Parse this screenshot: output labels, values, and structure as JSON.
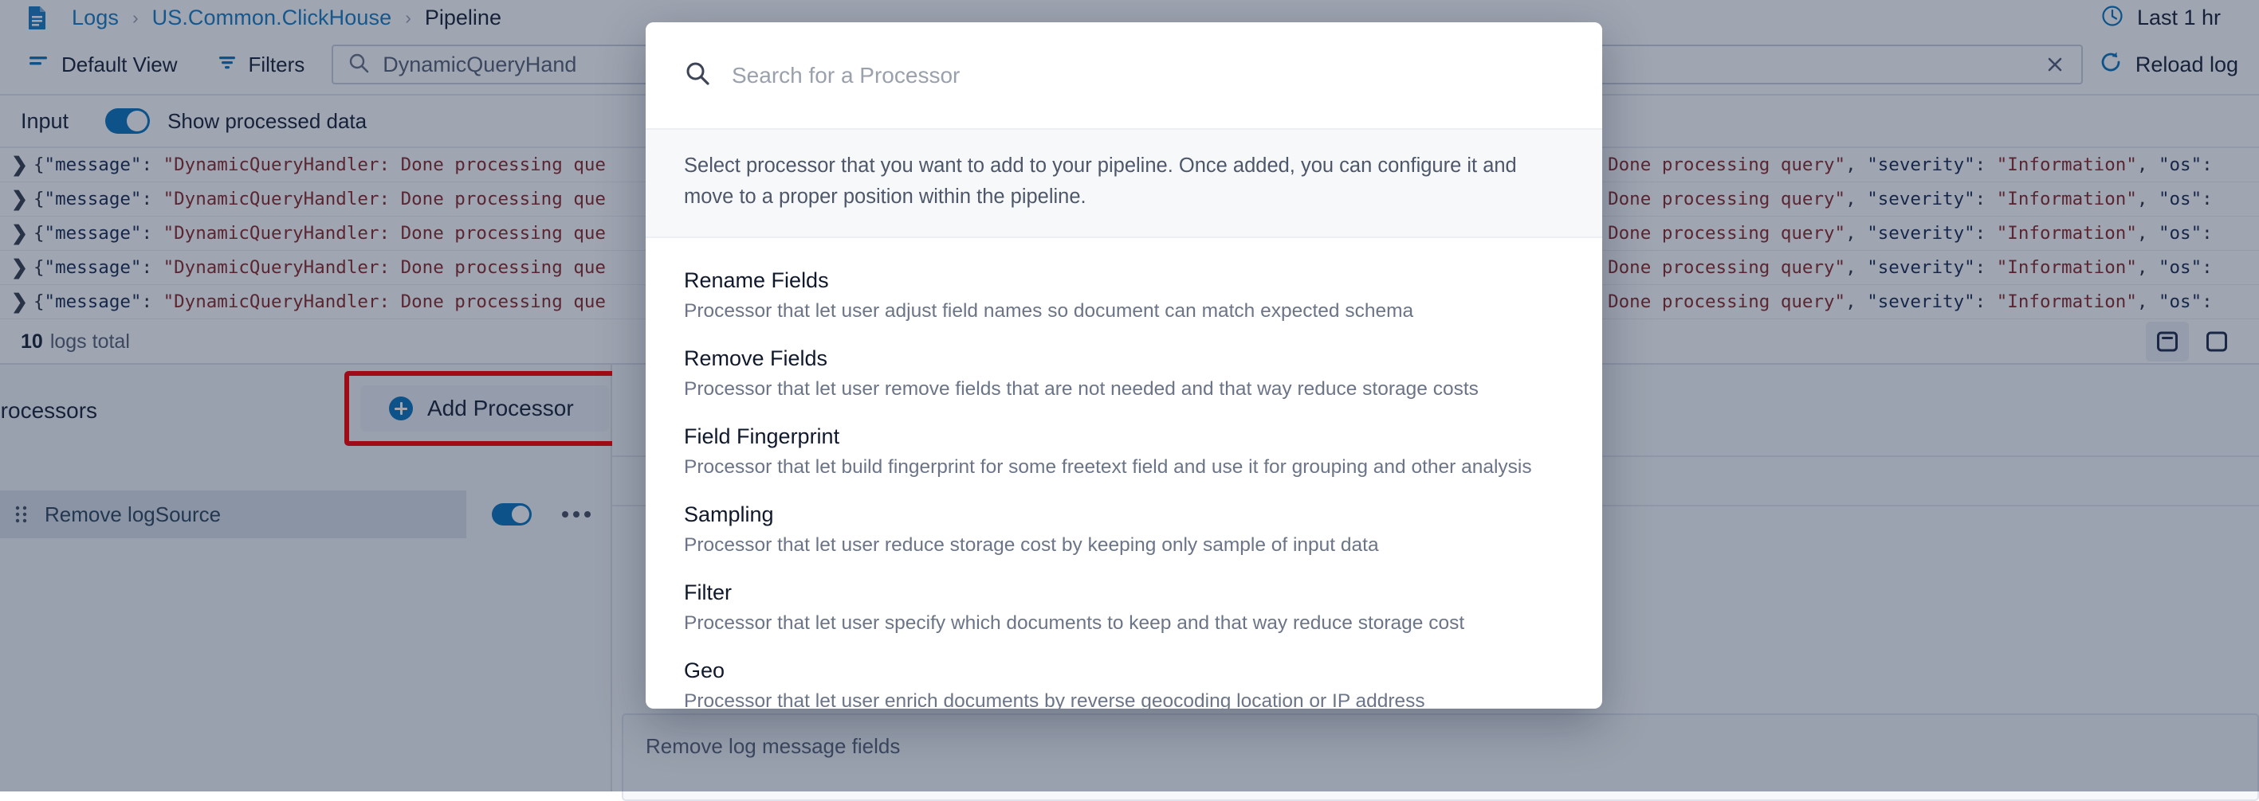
{
  "breadcrumb": {
    "icon": "document-icon",
    "items": [
      {
        "label": "Logs",
        "current": false
      },
      {
        "label": "US.Common.ClickHouse",
        "current": false
      },
      {
        "label": "Pipeline",
        "current": true
      }
    ],
    "separator": "›"
  },
  "time_range": {
    "icon": "clock-icon",
    "label": "Last 1 hr"
  },
  "toolbar": {
    "default_view_label": "Default View",
    "filters_label": "Filters",
    "search": {
      "value": "DynamicQueryHand",
      "clear_icon": "close-icon"
    },
    "reload_label": "Reload log",
    "reload_icon": "refresh-icon"
  },
  "input_strip": {
    "title": "Input",
    "toggle_on": true,
    "toggle_label": "Show processed data"
  },
  "logs": {
    "rows": [
      {
        "prefix": "{",
        "k1": "\"message\"",
        "sep": ": ",
        "v1": "\"DynamicQueryHandler: Done processing que",
        "tail_v": ": Done processing query\"",
        "tail_k": "\"severity\"",
        "tail_v2": "\"Information\"",
        "tail_k2": "\"os\""
      },
      {
        "prefix": "{",
        "k1": "\"message\"",
        "sep": ": ",
        "v1": "\"DynamicQueryHandler: Done processing que",
        "tail_v": ": Done processing query\"",
        "tail_k": "\"severity\"",
        "tail_v2": "\"Information\"",
        "tail_k2": "\"os\""
      },
      {
        "prefix": "{",
        "k1": "\"message\"",
        "sep": ": ",
        "v1": "\"DynamicQueryHandler: Done processing que",
        "tail_v": ": Done processing query\"",
        "tail_k": "\"severity\"",
        "tail_v2": "\"Information\"",
        "tail_k2": "\"os\""
      },
      {
        "prefix": "{",
        "k1": "\"message\"",
        "sep": ": ",
        "v1": "\"DynamicQueryHandler: Done processing que",
        "tail_v": ": Done processing query\"",
        "tail_k": "\"severity\"",
        "tail_v2": "\"Information\"",
        "tail_k2": "\"os\""
      },
      {
        "prefix": "{",
        "k1": "\"message\"",
        "sep": ": ",
        "v1": "\"DynamicQueryHandler: Done processing que",
        "tail_v": ": Done processing query\"",
        "tail_k": "\"severity\"",
        "tail_v2": "\"Information\"",
        "tail_k2": "\"os\""
      }
    ],
    "expand_glyph": "❯",
    "total_count": "10",
    "total_label": "logs total",
    "panel_icon": "panel-layout-icon"
  },
  "processors_pane": {
    "title": "Processors",
    "add_button_label": "Add Processor",
    "add_button_icon": "plus-circle-icon",
    "highlight_color": "#ff0000",
    "items": [
      {
        "name": "Remove logSource",
        "enabled": true,
        "drag_icon": "drag-grip-icon",
        "menu_icon": "kebab-menu-icon"
      }
    ]
  },
  "detail_pane": {
    "description_placeholder": "Remove log message fields"
  },
  "modal": {
    "search_placeholder": "Search for a Processor",
    "search_icon": "search-icon",
    "note": "Select processor that you want to add to your pipeline. Once added, you can configure it and move to a proper position within the pipeline.",
    "options": [
      {
        "name": "Rename Fields",
        "desc": "Processor that let user adjust field names so document can match expected schema"
      },
      {
        "name": "Remove Fields",
        "desc": "Processor that let user remove fields that are not needed and that way reduce storage costs"
      },
      {
        "name": "Field Fingerprint",
        "desc": "Processor that let build fingerprint for some freetext field and use it for grouping and other analysis"
      },
      {
        "name": "Sampling",
        "desc": "Processor that let user reduce storage cost by keeping only sample of input data"
      },
      {
        "name": "Filter",
        "desc": "Processor that let user specify which documents to keep and that way reduce storage cost"
      },
      {
        "name": "Geo",
        "desc": "Processor that let user enrich documents by reverse geocoding location or IP address"
      }
    ]
  },
  "colors": {
    "accent": "#0d76bd",
    "link": "#1b7fc4",
    "text": "#1c2539",
    "muted": "#6b7587",
    "highlight": "#ff0000",
    "overlay": "rgba(16,30,60,0.40)"
  }
}
